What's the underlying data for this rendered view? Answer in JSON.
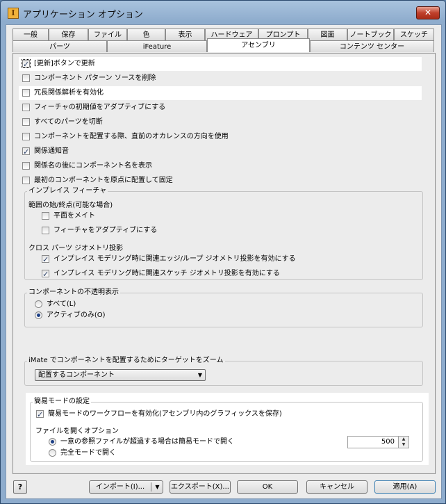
{
  "window": {
    "title": "アプリケーション オプション",
    "close": "✕",
    "app_icon": "I"
  },
  "tabs_row1": [
    "一般",
    "保存",
    "ファイル",
    "色",
    "表示",
    "ハードウェア",
    "プロンプト",
    "図面",
    "ノートブック",
    "スケッチ"
  ],
  "tabs_row2": [
    "パーツ",
    "iFeature",
    "アセンブリ",
    "コンテンツ センター"
  ],
  "options": {
    "defer_update": "[更新]ボタンで更新",
    "delete_pattern": "コンポーネント パターン ソースを削除",
    "redundant": "冗長関係解析を有効化",
    "adaptive_feature": "フィーチャの初期値をアダプティブにする",
    "section_parts": "すべてのパーツを切断",
    "occurrence_dir": "コンポーネントを配置する際、直前のオカレンスの方向を使用",
    "notify_sound": "関係通知音",
    "component_name": "関係名の後にコンポーネント名を表示",
    "ground_first": "最初のコンポーネントを原点に配置して固定"
  },
  "inplace": {
    "title": "インプレイス フィーチャ",
    "extent_label": "範囲の始/終点(可能な場合)",
    "mate_plane": "平面をメイト",
    "adaptive": "フィーチャをアダプティブにする",
    "cross_part_label": "クロス パーツ ジオメトリ投影",
    "loop_projection": "インプレイス モデリング時に関連エッジ/ループ ジオメトリ投影を有効にする",
    "sketch_projection": "インプレイス モデリング時に関連スケッチ ジオメトリ投影を有効にする"
  },
  "opacity": {
    "title": "コンポーネントの不透明表示",
    "all": "すべて(L)",
    "active": "アクティブのみ(O)"
  },
  "imate": {
    "title": "iMate でコンポーネントを配置するためにターゲットをズーム",
    "selected": "配置するコンポーネント"
  },
  "express": {
    "title": "簡易モードの設定",
    "enable": "簡易モードのワークフローを有効化(アセンブリ内のグラフィックスを保存)",
    "file_open_label": "ファイルを開くオプション",
    "open_express": "一意の参照ファイルが超過する場合は簡易モードで開く",
    "open_full": "完全モードで開く",
    "threshold": "500"
  },
  "buttons": {
    "help": "?",
    "import": "インポート(I)...",
    "export": "エクスポート(X)...",
    "ok": "OK",
    "cancel": "キャンセル",
    "apply": "適用(A)"
  }
}
